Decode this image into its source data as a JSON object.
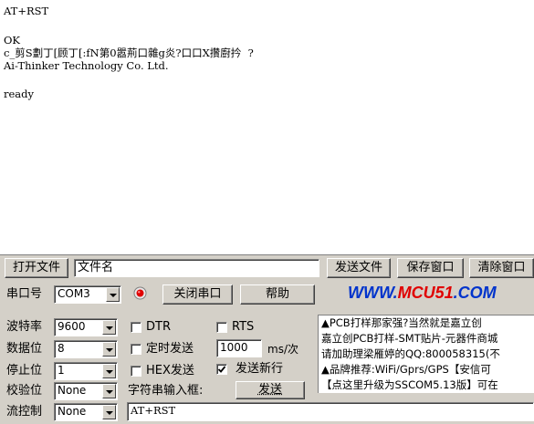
{
  "receive": {
    "lines": [
      "AT+RST",
      "",
      "OK",
      "c_剪S劃丁[顾丁[:fN第0嚣荊口雜g炎?口口X攢廚扲  ?",
      "Ai-Thinker Technology Co. Ltd.",
      "",
      "",
      "ready"
    ]
  },
  "toolbar": {
    "open_file_label": "打开文件",
    "filename_value": "文件名",
    "send_file_label": "发送文件",
    "save_window_label": "保存窗口",
    "clear_window_label": "清除窗口"
  },
  "port": {
    "label": "串口号",
    "value": "COM3",
    "close_label": "关闭串口",
    "help_label": "帮助",
    "brand_prefix": "WWW.",
    "brand_name": "MCU51",
    "brand_suffix": ".COM"
  },
  "settings": {
    "baud_label": "波特率",
    "baud_value": "9600",
    "data_bits_label": "数据位",
    "data_bits_value": "8",
    "stop_bits_label": "停止位",
    "stop_bits_value": "1",
    "parity_label": "校验位",
    "parity_value": "None",
    "flow_label": "流控制",
    "flow_value": "None"
  },
  "options": {
    "dtr_label": "DTR",
    "dtr_checked": false,
    "rts_label": "RTS",
    "rts_checked": false,
    "timed_send_label": "定时发送",
    "timed_send_checked": false,
    "interval_value": "1000",
    "interval_unit": "ms/次",
    "hex_send_label": "HEX发送",
    "hex_send_checked": false,
    "newline_label": "发送新行",
    "newline_checked": true,
    "input_label": "字符串输入框:",
    "send_label": "发送",
    "input_value": "AT+RST"
  },
  "ad": {
    "lines": [
      "▲PCB打样那家强?当然就是嘉立创",
      "嘉立创PCB打样-SMT贴片-元器件商城",
      "请加助理梁雁婷的QQ:800058315(不",
      "▲品牌推荐:WiFi/Gprs/GPS【安信可",
      "【点这里升级为SSCOM5.13版】可在"
    ]
  },
  "colors": {
    "background": "#d4d0c8",
    "brand": "#0033cc"
  }
}
